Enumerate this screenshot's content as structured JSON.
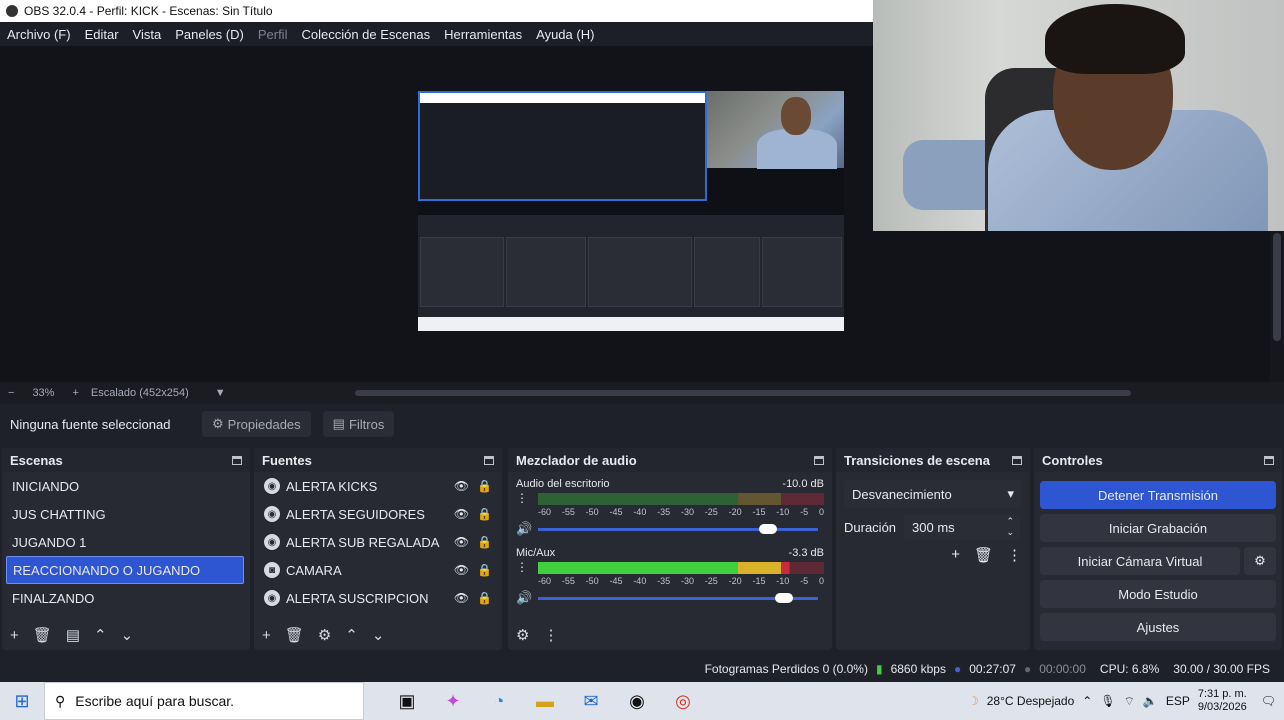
{
  "title": "OBS 32.0.4 - Perfil: KICK - Escenas: Sin Título",
  "menu": [
    "Archivo (F)",
    "Editar",
    "Vista",
    "Paneles (D)",
    "Perfil",
    "Colección de Escenas",
    "Herramientas",
    "Ayuda (H)"
  ],
  "zoom": {
    "minus": "−",
    "value": "33%",
    "plus": "+",
    "scale": "Escalado (452x254)"
  },
  "source_bar": {
    "none": "Ninguna fuente seleccionad",
    "properties": "Propiedades",
    "filters": "Filtros"
  },
  "scenes": {
    "title": "Escenas",
    "items": [
      "INICIANDO",
      "JUS CHATTING",
      "JUGANDO 1",
      "REACCIONANDO O JUGANDO",
      "FINALZANDO"
    ]
  },
  "sources": {
    "title": "Fuentes",
    "items": [
      "ALERTA KICKS",
      "ALERTA SEGUIDORES",
      "ALERTA SUB REGALADA",
      "CAMARA",
      "ALERTA SUSCRIPCION"
    ]
  },
  "mixer": {
    "title": "Mezclador de audio",
    "channels": [
      {
        "name": "Audio del escritorio",
        "db": "-10.0 dB",
        "level": 0.0,
        "volume": 0.82
      },
      {
        "name": "Mic/Aux",
        "db": "-3.3 dB",
        "level": 0.88,
        "volume": 0.88
      }
    ],
    "ticks": [
      "-60",
      "-55",
      "-50",
      "-45",
      "-40",
      "-35",
      "-30",
      "-25",
      "-20",
      "-15",
      "-10",
      "-5",
      "0"
    ]
  },
  "transitions": {
    "title": "Transiciones de escena",
    "selected": "Desvanecimiento",
    "duration_label": "Duración",
    "duration": "300 ms"
  },
  "controls": {
    "title": "Controles",
    "stop": "Detener Transmisión",
    "record": "Iniciar Grabación",
    "virtual": "Iniciar Cámara Virtual",
    "studio": "Modo Estudio",
    "settings": "Ajustes"
  },
  "status": {
    "dropped": "Fotogramas Perdidos 0 (0.0%)",
    "bitrate": "6860 kbps",
    "live_time": "00:27:07",
    "rec_time": "00:00:00",
    "cpu": "CPU: 6.8%",
    "fps": "30.00 / 30.00 FPS"
  },
  "taskbar": {
    "search": "Escribe aquí para buscar.",
    "weather": "28°C  Despejado",
    "lang": "ESP",
    "time": "7:31 p. m.",
    "date": "9/03/2026"
  },
  "colors": {
    "accent": "#2e55d2",
    "green": "#3fcf3f",
    "yellow": "#d9b22a",
    "red": "#cc2a3a"
  }
}
